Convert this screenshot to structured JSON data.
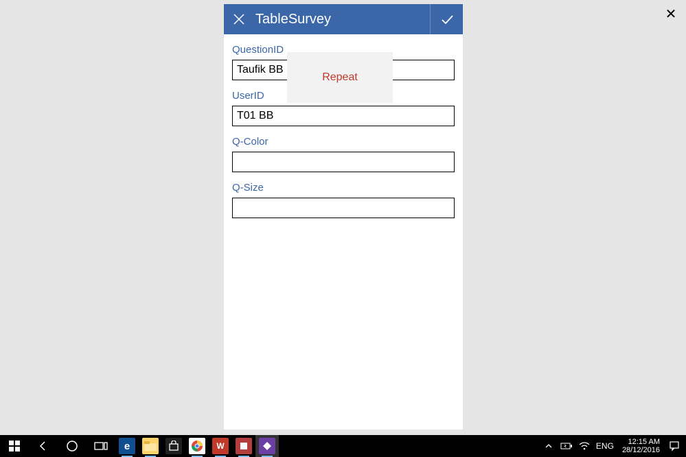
{
  "window": {
    "close_glyph": "✕"
  },
  "header": {
    "title": "TableSurvey",
    "close_glyph": "✕",
    "submit_glyph": "✓"
  },
  "tooltip": {
    "text": "Repeat"
  },
  "fields": {
    "questionId": {
      "label": "QuestionID",
      "value": "Taufik BB"
    },
    "userId": {
      "label": "UserID",
      "value": "T01 BB"
    },
    "qColor": {
      "label": "Q-Color",
      "value": ""
    },
    "qSize": {
      "label": "Q-Size",
      "value": ""
    }
  },
  "taskbar": {
    "lang": "ENG",
    "time": "12:15 AM",
    "date": "28/12/2016",
    "tray": {
      "chevron": "＾",
      "battery": "🗲",
      "wifi": "⚙",
      "notif": "💬"
    },
    "apps": {
      "edge": "e",
      "explorer": "🗂",
      "store": "🛍",
      "chrome": "●",
      "red": "W",
      "office": "■",
      "purple": "◆"
    }
  }
}
